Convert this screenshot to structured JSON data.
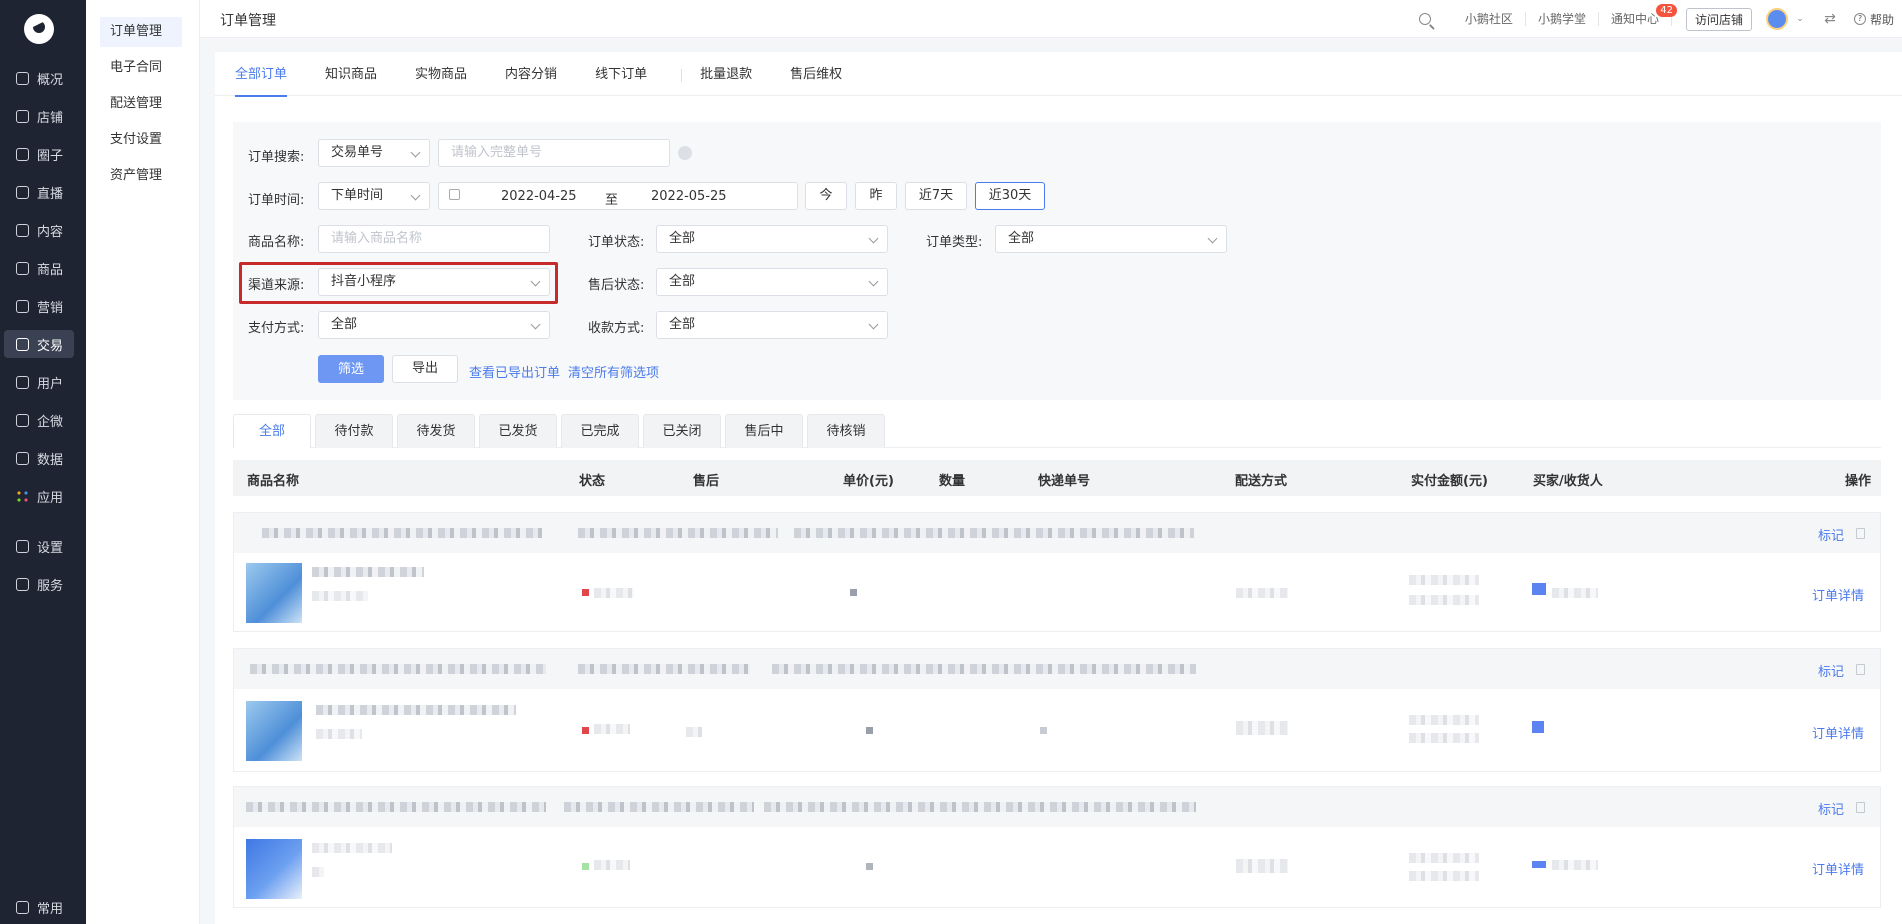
{
  "sidebar": {
    "items": [
      {
        "label": "概况",
        "icon": "overview-icon"
      },
      {
        "label": "店铺",
        "icon": "store-icon"
      },
      {
        "label": "圈子",
        "icon": "circle-icon"
      },
      {
        "label": "直播",
        "icon": "live-icon"
      },
      {
        "label": "内容",
        "icon": "content-icon"
      },
      {
        "label": "商品",
        "icon": "product-icon"
      },
      {
        "label": "营销",
        "icon": "marketing-icon"
      },
      {
        "label": "交易",
        "icon": "trade-icon"
      },
      {
        "label": "用户",
        "icon": "user-icon"
      },
      {
        "label": "企微",
        "icon": "wecom-icon"
      },
      {
        "label": "数据",
        "icon": "data-icon"
      },
      {
        "label": "应用",
        "icon": "apps-icon"
      },
      {
        "label": "设置",
        "icon": "settings-icon"
      },
      {
        "label": "服务",
        "icon": "service-icon"
      }
    ],
    "bottom_label": "常用",
    "active": "交易"
  },
  "subnav": {
    "items": [
      "订单管理",
      "电子合同",
      "配送管理",
      "支付设置",
      "资产管理"
    ],
    "active": "订单管理"
  },
  "topbar": {
    "title": "订单管理",
    "community": "小鹅社区",
    "school": "小鹅学堂",
    "notice": "通知中心",
    "notice_count": "42",
    "visit_store": "访问店铺",
    "help": "帮助"
  },
  "tabs": [
    "全部订单",
    "知识商品",
    "实物商品",
    "内容分销",
    "线下订单",
    "批量退款",
    "售后维权"
  ],
  "filter": {
    "search_label": "订单搜索:",
    "search_type": "交易单号",
    "search_placeholder": "请输入完整单号",
    "time_label": "订单时间:",
    "time_type": "下单时间",
    "date_from": "2022-04-25",
    "date_to_sep": "至",
    "date_to": "2022-05-25",
    "quick": [
      "今",
      "昨",
      "近7天",
      "近30天"
    ],
    "quick_active": "近30天",
    "product_label": "商品名称:",
    "product_placeholder": "请输入商品名称",
    "order_status_label": "订单状态:",
    "order_status": "全部",
    "order_type_label": "订单类型:",
    "order_type": "全部",
    "channel_label": "渠道来源:",
    "channel": "抖音小程序",
    "aftersale_label": "售后状态:",
    "aftersale": "全部",
    "pay_method_label": "支付方式:",
    "pay_method": "全部",
    "collect_label": "收款方式:",
    "collect": "全部",
    "filter_btn": "筛选",
    "export_btn": "导出",
    "view_exported": "查看已导出订单",
    "clear_all": "清空所有筛选项"
  },
  "status_tabs": [
    "全部",
    "待付款",
    "待发货",
    "已发货",
    "已完成",
    "已关闭",
    "售后中",
    "待核销"
  ],
  "table": {
    "headers": [
      "商品名称",
      "状态",
      "售后",
      "单价(元)",
      "数量",
      "快递单号",
      "配送方式",
      "实付金额(元)",
      "买家/收货人",
      "操作"
    ]
  },
  "orders": [
    {
      "mark": "标记",
      "detail": "订单详情"
    },
    {
      "mark": "标记",
      "detail": "订单详情"
    },
    {
      "mark": "标记",
      "detail": "订单详情"
    }
  ],
  "colors": {
    "accent": "#4b7bec",
    "sidebar_bg": "#1f2433",
    "highlight": "#c62a2a",
    "primary_btn": "#6d97f2"
  }
}
